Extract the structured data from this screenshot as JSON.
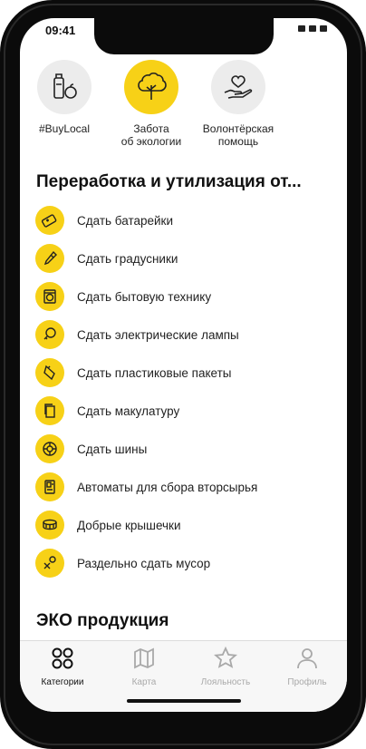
{
  "status": {
    "time": "09:41"
  },
  "categories": [
    {
      "label": "#BuyLocal",
      "icon": "bottle-apple-icon",
      "active": false
    },
    {
      "label": "Забота\nоб экологии",
      "icon": "tree-icon",
      "active": true
    },
    {
      "label": "Волонтёрская\nпомощь",
      "icon": "hand-heart-icon",
      "active": false
    }
  ],
  "recycling": {
    "title": "Переработка и утилизация от...",
    "items": [
      {
        "label": "Сдать батарейки",
        "icon": "battery-icon"
      },
      {
        "label": "Сдать градусники",
        "icon": "thermometer-icon"
      },
      {
        "label": "Сдать бытовую технику",
        "icon": "washing-machine-icon"
      },
      {
        "label": "Сдать электрические лампы",
        "icon": "lightbulb-icon"
      },
      {
        "label": "Сдать пластиковые пакеты",
        "icon": "plastic-bag-icon"
      },
      {
        "label": "Сдать макулатуру",
        "icon": "paper-icon"
      },
      {
        "label": "Сдать шины",
        "icon": "tire-icon"
      },
      {
        "label": "Автоматы для сбора вторсырья",
        "icon": "vending-machine-icon"
      },
      {
        "label": "Добрые крышечки",
        "icon": "bottle-cap-icon"
      },
      {
        "label": "Раздельно сдать мусор",
        "icon": "sorting-icon"
      }
    ]
  },
  "eco": {
    "title": "ЭКО продукция"
  },
  "tabbar": {
    "items": [
      {
        "label": "Категории",
        "icon": "grid-icon",
        "active": true
      },
      {
        "label": "Карта",
        "icon": "map-icon",
        "active": false
      },
      {
        "label": "Лояльность",
        "icon": "star-icon",
        "active": false
      },
      {
        "label": "Профиль",
        "icon": "person-icon",
        "active": false
      }
    ]
  },
  "colors": {
    "accent": "#f7d117",
    "inactive_circle": "#ececec",
    "text": "#222222",
    "tab_inactive": "#a9a9a9"
  }
}
